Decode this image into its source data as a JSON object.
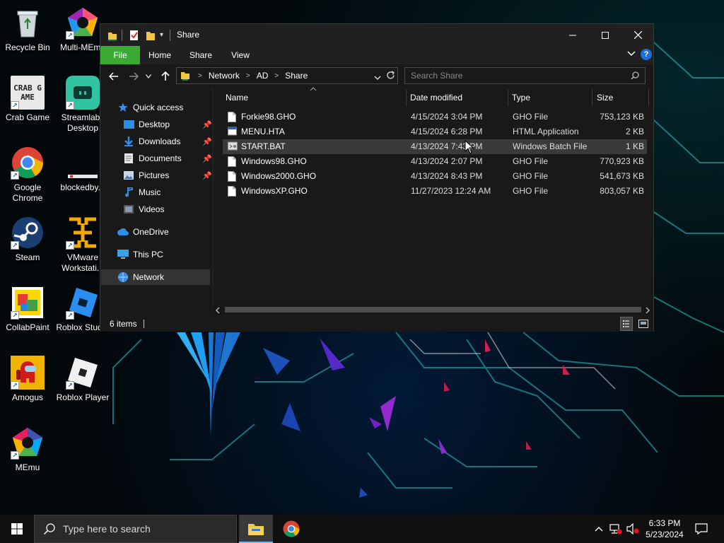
{
  "desktop": {
    "icons": [
      {
        "label": "Recycle Bin"
      },
      {
        "label": "Multi-MEmu"
      },
      {
        "label": "Crab Game"
      },
      {
        "label": "Streamlabs Desktop"
      },
      {
        "label": "Google Chrome"
      },
      {
        "label": "blockedby..."
      },
      {
        "label": "Steam"
      },
      {
        "label": "VMware Workstati..."
      },
      {
        "label": "CollabPaint"
      },
      {
        "label": "Roblox Stud..."
      },
      {
        "label": "Amogus"
      },
      {
        "label": "Roblox Player"
      },
      {
        "label": "MEmu"
      }
    ],
    "crab_logo_text": "CRAB GAME"
  },
  "explorer": {
    "title": "Share",
    "ribbon": {
      "file": "File",
      "home": "Home",
      "share": "Share",
      "view": "View"
    },
    "help_glyph": "?",
    "address": {
      "crumbs": [
        "Network",
        "AD",
        "Share"
      ]
    },
    "search": {
      "placeholder": "Search Share"
    },
    "sidebar": {
      "quick_access": "Quick access",
      "desktop": "Desktop",
      "downloads": "Downloads",
      "documents": "Documents",
      "pictures": "Pictures",
      "music": "Music",
      "videos": "Videos",
      "onedrive": "OneDrive",
      "this_pc": "This PC",
      "network": "Network"
    },
    "columns": {
      "name": "Name",
      "date": "Date modified",
      "type": "Type",
      "size": "Size"
    },
    "files": [
      {
        "name": "Forkie98.GHO",
        "date": "4/15/2024 3:04 PM",
        "type": "GHO File",
        "size": "753,123 KB"
      },
      {
        "name": "MENU.HTA",
        "date": "4/15/2024 6:28 PM",
        "type": "HTML Application",
        "size": "2 KB"
      },
      {
        "name": "START.BAT",
        "date": "4/13/2024 7:43 PM",
        "type": "Windows Batch File",
        "size": "1 KB",
        "selected": true
      },
      {
        "name": "Windows98.GHO",
        "date": "4/13/2024 2:07 PM",
        "type": "GHO File",
        "size": "770,923 KB"
      },
      {
        "name": "Windows2000.GHO",
        "date": "4/13/2024 8:43 PM",
        "type": "GHO File",
        "size": "541,673 KB"
      },
      {
        "name": "WindowsXP.GHO",
        "date": "11/27/2023 12:24 AM",
        "type": "GHO File",
        "size": "803,057 KB"
      }
    ],
    "status": {
      "item_count": "6 items"
    },
    "colors": {
      "file_tab": "#3aaa35",
      "selection": "#3a3a3a",
      "folder": "#f2c744",
      "accent_blue": "#1f8fff"
    }
  },
  "taskbar": {
    "search_placeholder": "Type here to search",
    "clock": {
      "time": "6:33 PM",
      "date": "5/23/2024"
    }
  }
}
